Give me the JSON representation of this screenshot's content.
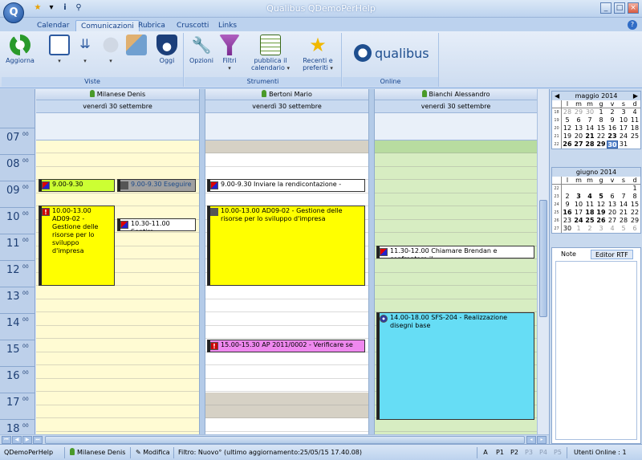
{
  "app": {
    "title": "Qualibus     QDemoPerHelp",
    "orb_label": "Q",
    "qat_icons": [
      "star-icon",
      "dropdown-icon",
      "info-icon",
      "tool-icon"
    ],
    "window_buttons": [
      "_",
      "□",
      "×"
    ]
  },
  "tabs": [
    {
      "label": "Calendar",
      "active": false
    },
    {
      "label": "Comunicazioni",
      "active": true
    },
    {
      "label": "Rubrica",
      "active": false
    },
    {
      "label": "Cruscotti",
      "active": false
    },
    {
      "label": "Links",
      "active": false
    }
  ],
  "ribbon": {
    "viste": {
      "label": "Viste",
      "aggiorna": "Aggiorna",
      "oggi": "Oggi"
    },
    "strumenti": {
      "label": "Strumenti",
      "opzioni": "Opzioni",
      "filtri": "Filtri",
      "pubblica": "pubblica il",
      "pubblica2": "calendario",
      "recenti": "Recenti e",
      "recenti2": "preferiti"
    },
    "online": {
      "label": "Online",
      "logo": "qualibus"
    }
  },
  "columns": [
    {
      "person": "Milanese Denis",
      "date": "venerdì 30 settembre"
    },
    {
      "person": "Bertoni Mario",
      "date": "venerdì 30 settembre"
    },
    {
      "person": "Bianchi Alessandro",
      "date": "venerdì 30 settembre"
    }
  ],
  "hours": [
    {
      "h": "07",
      "m": "00"
    },
    {
      "h": "08",
      "m": "00"
    },
    {
      "h": "09",
      "m": "00"
    },
    {
      "h": "10",
      "m": "00"
    },
    {
      "h": "11",
      "m": "00"
    },
    {
      "h": "12",
      "m": "00"
    },
    {
      "h": "13",
      "m": "00"
    },
    {
      "h": "14",
      "m": "00"
    },
    {
      "h": "15",
      "m": "00"
    },
    {
      "h": "16",
      "m": "00"
    },
    {
      "h": "17",
      "m": "00"
    },
    {
      "h": "18",
      "m": "00"
    }
  ],
  "appointments": {
    "a1": "9.00-9.30",
    "a2": "9.00-9.30 Eseguire",
    "a3": "10.00-13.00 AD09-02 - Gestione delle risorse per lo sviluppo d'impresa",
    "a4": "10.30-11.00 Sentire",
    "b1": "9.00-9.30 Inviare la rendicontazione -",
    "b2": "10.00-13.00  AD09-02 - Gestione delle risorse per lo sviluppo d'impresa",
    "b3": "15.00-15.30  AP 2011/0002 - Verificare se",
    "c1": "11.30-12.00 Chiamare Brendan e confrontare il",
    "c2": "14.00-18.00 SFS-204 - Realizzazione disegni base"
  },
  "colors": {
    "yellow": "#ffff00",
    "lime": "#ccff33",
    "gray": "#a0a0a0",
    "magenta": "#ee88ee",
    "cyan": "#66ddf5",
    "col1_bg": "#fffbd3",
    "col3_bg": "#d7edc2"
  },
  "minical_may": {
    "title": "maggio 2014",
    "days": [
      "l",
      "m",
      "m",
      "g",
      "v",
      "s",
      "d"
    ],
    "weeks": [
      {
        "wk": "18",
        "d": [
          "28",
          "29",
          "30",
          "1",
          "2",
          "3",
          "4"
        ]
      },
      {
        "wk": "19",
        "d": [
          "5",
          "6",
          "7",
          "8",
          "9",
          "10",
          "11"
        ]
      },
      {
        "wk": "20",
        "d": [
          "12",
          "13",
          "14",
          "15",
          "16",
          "17",
          "18"
        ]
      },
      {
        "wk": "21",
        "d": [
          "19",
          "20",
          "21",
          "22",
          "23",
          "24",
          "25"
        ]
      },
      {
        "wk": "22",
        "d": [
          "26",
          "27",
          "28",
          "29",
          "30",
          "31",
          ""
        ]
      }
    ]
  },
  "minical_june": {
    "title": "giugno 2014",
    "days": [
      "l",
      "m",
      "m",
      "g",
      "v",
      "s",
      "d"
    ],
    "weeks": [
      {
        "wk": "22",
        "d": [
          "",
          "",
          "",
          "",
          "",
          "",
          "1"
        ]
      },
      {
        "wk": "23",
        "d": [
          "2",
          "3",
          "4",
          "5",
          "6",
          "7",
          "8"
        ]
      },
      {
        "wk": "24",
        "d": [
          "9",
          "10",
          "11",
          "12",
          "13",
          "14",
          "15"
        ]
      },
      {
        "wk": "25",
        "d": [
          "16",
          "17",
          "18",
          "19",
          "20",
          "21",
          "22"
        ]
      },
      {
        "wk": "26",
        "d": [
          "23",
          "24",
          "25",
          "26",
          "27",
          "28",
          "29"
        ]
      },
      {
        "wk": "27",
        "d": [
          "30",
          "1",
          "2",
          "3",
          "4",
          "5",
          "6"
        ]
      }
    ]
  },
  "notes": {
    "tab_note": "Note",
    "tab_rtf": "Editor RTF"
  },
  "status": {
    "db": "QDemoPerHelp",
    "user": "Milanese Denis",
    "mode": "Modifica",
    "filter": "Filtro: Nuovo° (ultimo aggiornamento:25/05/15 17.40.08)",
    "a": "A",
    "p1": "P1",
    "p2": "P2",
    "p3": "P3",
    "p4": "P4",
    "p5": "P5",
    "online": "Utenti Online : 1"
  }
}
